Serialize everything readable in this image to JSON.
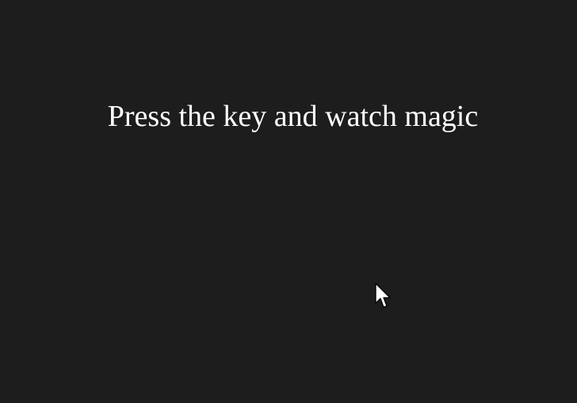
{
  "main": {
    "headline": "Press the key and watch magic"
  },
  "cursor": {
    "icon": "mouse-pointer-icon"
  },
  "colors": {
    "background": "#1d1d1d",
    "text": "#ffffff"
  }
}
